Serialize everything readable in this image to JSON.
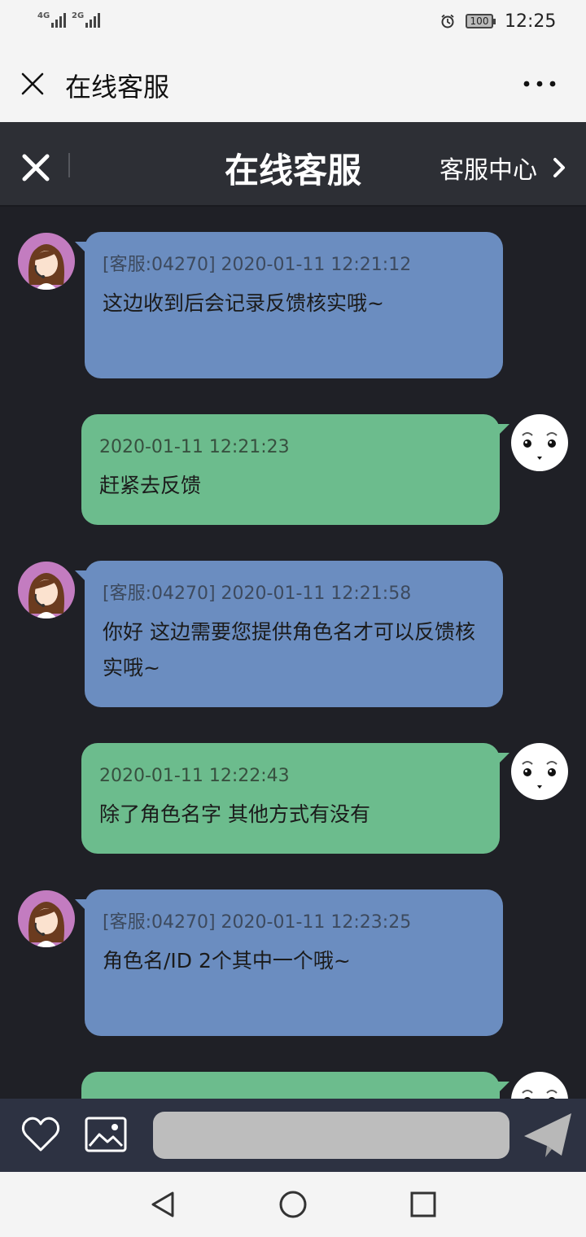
{
  "status_bar": {
    "signal_1": "4G",
    "signal_2": "2G",
    "battery": "100",
    "time": "12:25"
  },
  "app_bar": {
    "title": "在线客服",
    "close_icon": "close-icon",
    "more_icon": "more-icon"
  },
  "chat_header": {
    "title": "在线客服",
    "service_center": "客服中心",
    "close_icon": "close-icon",
    "chevron_icon": "chevron-right-icon"
  },
  "messages": [
    {
      "sender": "agent",
      "meta": "[客服:04270] 2020-01-11 12:21:12",
      "text": "这边收到后会记录反馈核实哦~"
    },
    {
      "sender": "user",
      "meta": "2020-01-11 12:21:23",
      "text": "赶紧去反馈"
    },
    {
      "sender": "agent",
      "meta": "[客服:04270] 2020-01-11 12:21:58",
      "text": "你好 这边需要您提供角色名才可以反馈核实哦~"
    },
    {
      "sender": "user",
      "meta": "2020-01-11 12:22:43",
      "text": "除了角色名字 其他方式有没有"
    },
    {
      "sender": "agent",
      "meta": "[客服:04270] 2020-01-11 12:23:25",
      "text": "角色名/ID 2个其中一个哦~"
    },
    {
      "sender": "user",
      "meta": "",
      "text": ""
    }
  ],
  "input_bar": {
    "placeholder": "",
    "value": "",
    "icons": [
      "heart-icon",
      "image-icon",
      "send-icon"
    ]
  },
  "nav_bar": {
    "icons": [
      "back-icon",
      "home-icon",
      "recents-icon"
    ]
  },
  "colors": {
    "background": "#1f2026",
    "agent_bubble": "#6b8dc0",
    "user_bubble": "#6cbc8d",
    "header": "#2d2f35",
    "input_bar": "#2d3242"
  }
}
